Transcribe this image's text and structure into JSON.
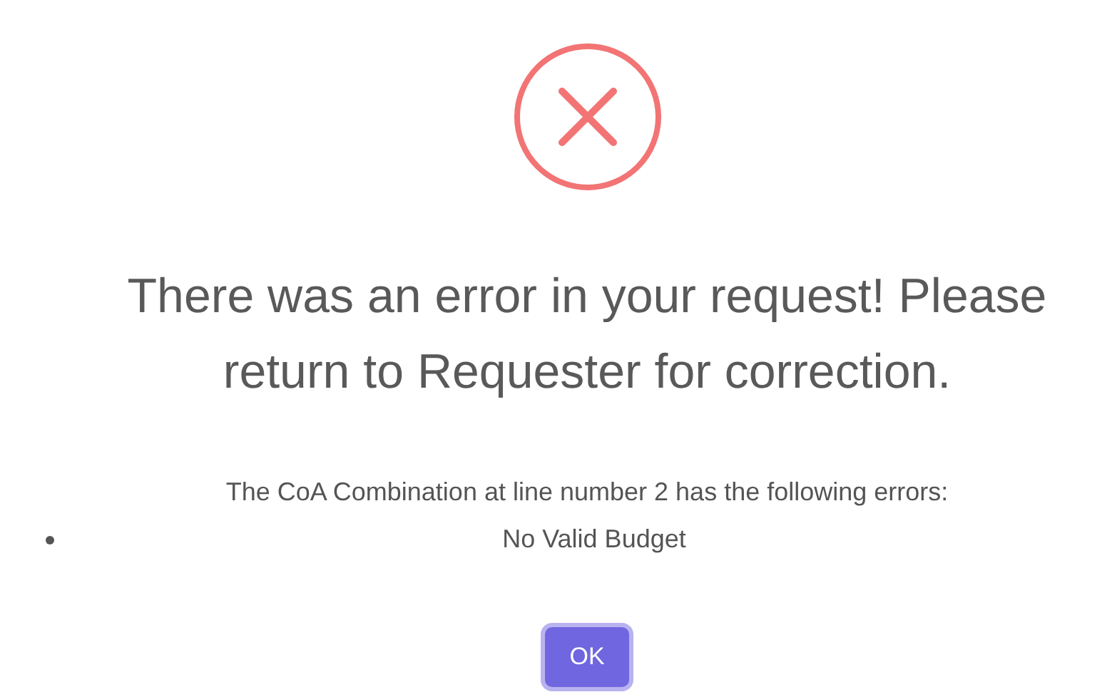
{
  "dialog": {
    "icon": {
      "kind": "error"
    },
    "title": "There was an error in your request! Please return to Requester for correction.",
    "message": "The CoA Combination at line number **2** has the following errors:",
    "errors": [
      "No Valid Budget"
    ],
    "buttons": [
      {
        "label": "OK",
        "focused": true
      }
    ]
  }
}
